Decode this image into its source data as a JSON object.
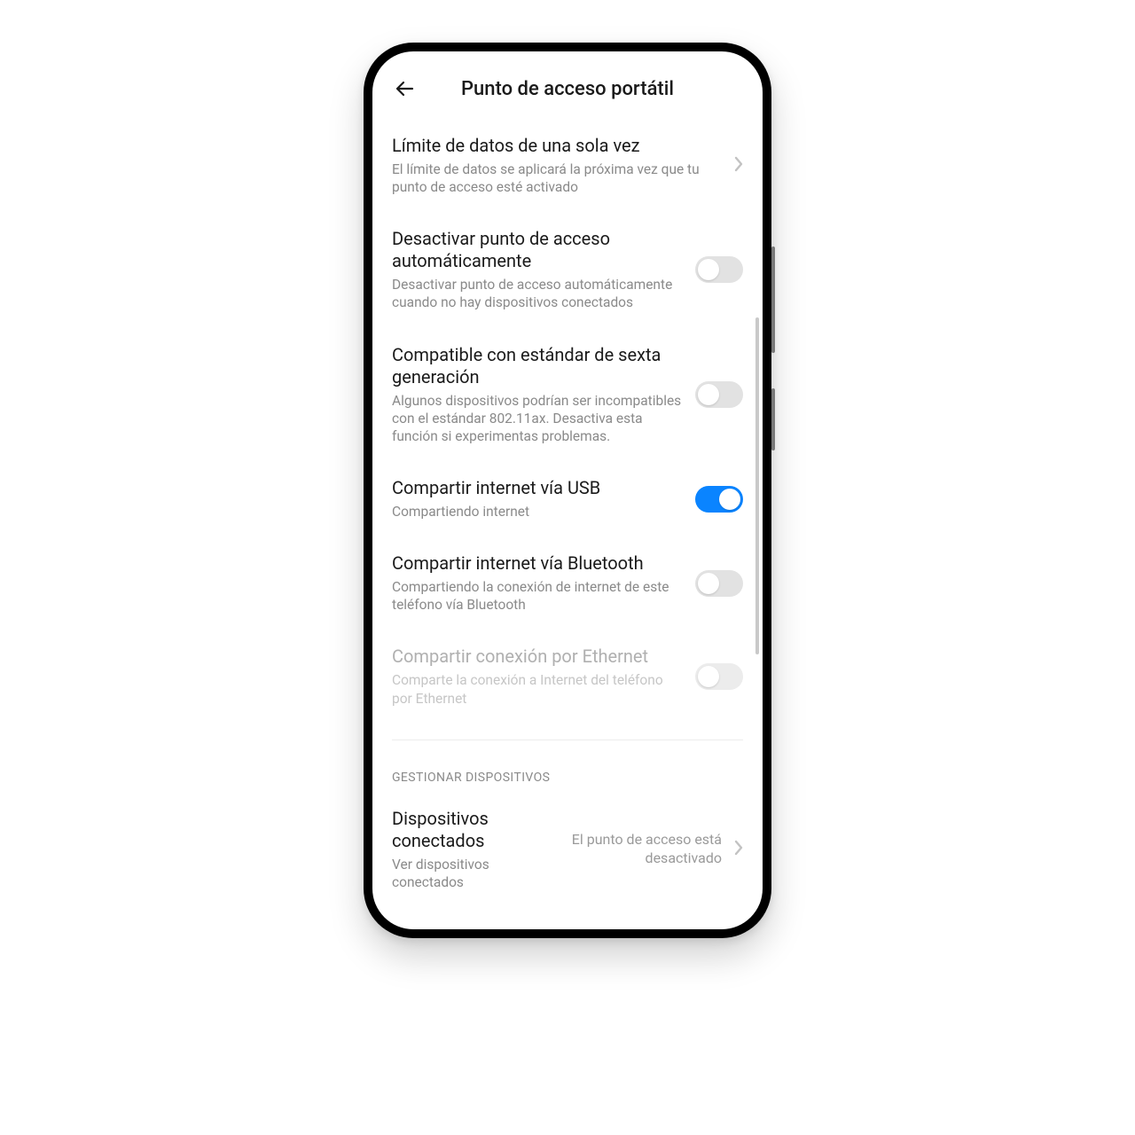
{
  "header": {
    "title": "Punto de acceso portátil"
  },
  "items": {
    "data_limit": {
      "label": "Límite de datos de una sola vez",
      "sub": "El límite de datos se aplicará la próxima vez que tu punto de acceso esté activado"
    },
    "auto_off": {
      "label": "Desactivar punto de acceso automáticamente",
      "sub": "Desactivar punto de acceso automáticamente cuando no hay dispositivos conectados"
    },
    "gen6": {
      "label": "Compatible con estándar de sexta generación",
      "sub": "Algunos dispositivos podrían ser incompatibles con el estándar 802.11ax. Desactiva esta función si experimentas problemas."
    },
    "usb": {
      "label": "Compartir internet vía USB",
      "sub": "Compartiendo internet"
    },
    "bt": {
      "label": "Compartir internet vía Bluetooth",
      "sub": "Compartiendo la conexión de internet de este teléfono vía Bluetooth"
    },
    "eth": {
      "label": "Compartir conexión por Ethernet",
      "sub": "Comparte la conexión a Internet del teléfono por Ethernet"
    }
  },
  "section": {
    "manage": "GESTIONAR DISPOSITIVOS"
  },
  "connected": {
    "label": "Dispositivos conectados",
    "sub": "Ver dispositivos conectados",
    "value": "El punto de acceso está desactivado"
  },
  "toggles": {
    "auto_off": false,
    "gen6": false,
    "usb": true,
    "bt": false,
    "eth": false
  }
}
